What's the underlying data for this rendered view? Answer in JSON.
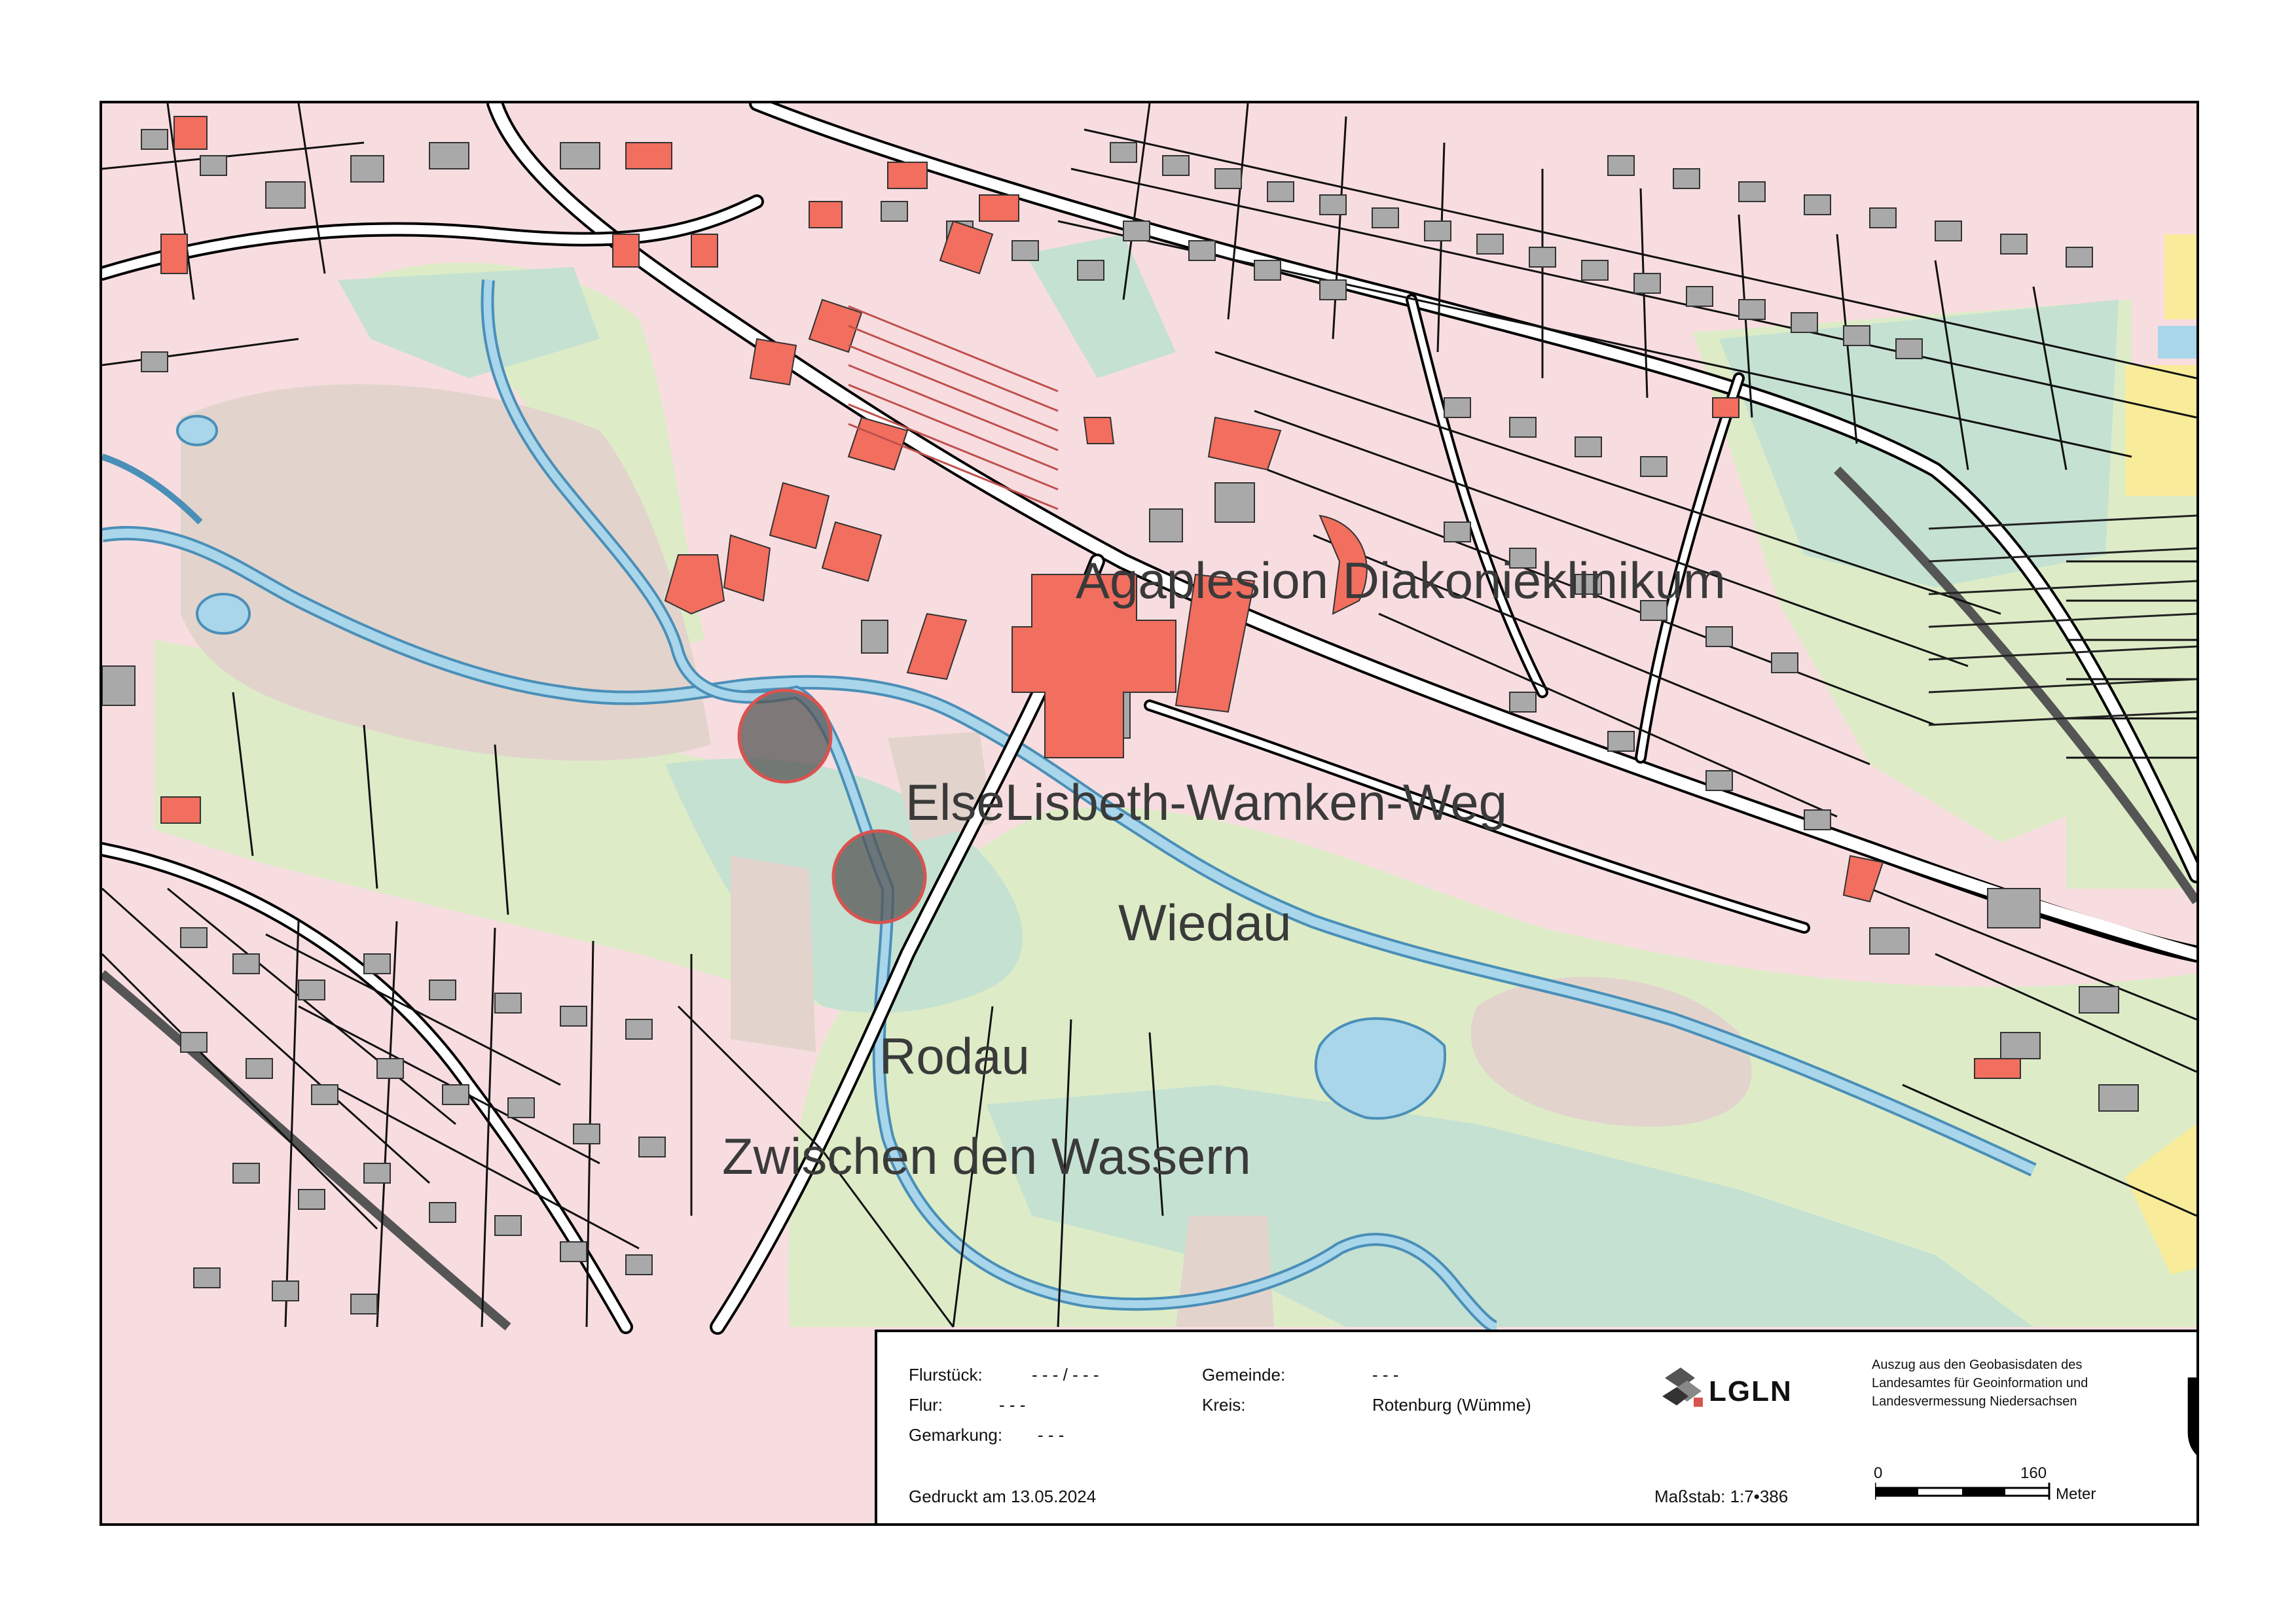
{
  "map": {
    "labels": {
      "hospital": "Agaplesion Diakonieklinikum",
      "street": "ElseLisbeth-Wamken-Weg",
      "river1": "Wiedau",
      "river2": "Rodau",
      "area": "Zwischen den Wassern"
    },
    "markers": [
      "circle-marker",
      "circle-marker"
    ],
    "colors": {
      "residential": "#f8dde0",
      "building": "#a9a9a9",
      "public_building": "#f26e5e",
      "meadow": "#ddecc7",
      "wetland": "#c5e1d2",
      "field": "#e2d4cd",
      "water": "#a9d6ea",
      "water_outline": "#4a8fb8",
      "rail_yellow": "#f8ec9a"
    }
  },
  "info": {
    "flurstueck_label": "Flurstück:",
    "flurstueck_value": "- - -  /  - - -",
    "flur_label": "Flur:",
    "flur_value": "- - -",
    "gemarkung_label": "Gemarkung:",
    "gemarkung_value": "- - -",
    "gemeinde_label": "Gemeinde:",
    "gemeinde_value": "- - -",
    "kreis_label": "Kreis:",
    "kreis_value": "Rotenburg (Wümme)",
    "printed": "Gedruckt am 13.05.2024",
    "scale": "Maßstab: 1:7•386",
    "logo_text": "LGLN",
    "source_line1": "Auszug aus den Geobasisdaten des",
    "source_line2": "Landesamtes für Geoinformation und",
    "source_line3": "Landesvermessung Niedersachsen",
    "scalebar_0": "0",
    "scalebar_160": "160",
    "scalebar_unit": "Meter",
    "overview_mark": "Ü"
  }
}
